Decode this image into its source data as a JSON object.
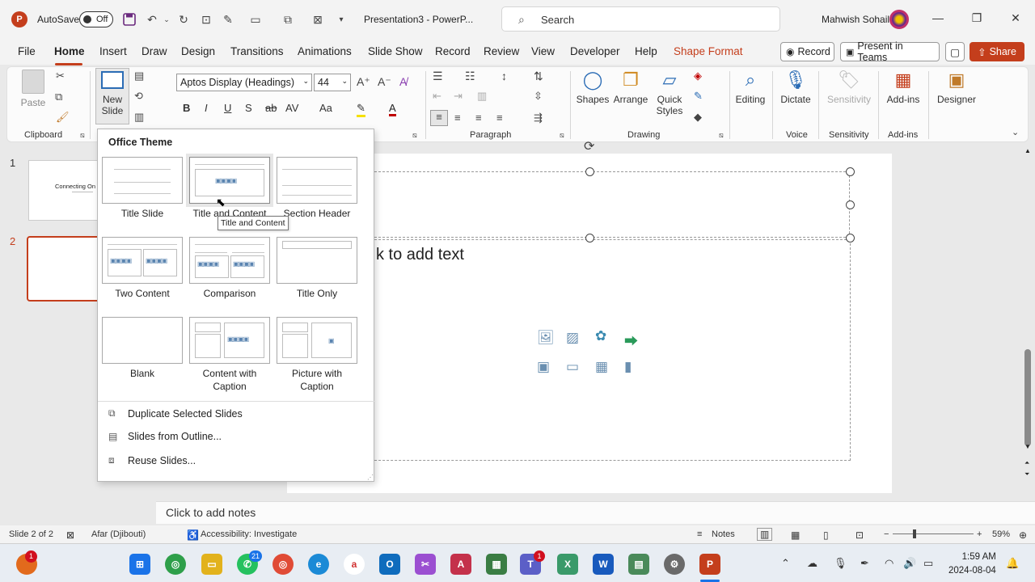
{
  "titlebar": {
    "autosave_label": "AutoSave",
    "autosave_state": "Off",
    "doc_title": "Presentation3  -  PowerP...",
    "search_placeholder": "Search",
    "user_name": "Mahwish Sohail"
  },
  "tabs": [
    "File",
    "Home",
    "Insert",
    "Draw",
    "Design",
    "Transitions",
    "Animations",
    "Slide Show",
    "Record",
    "Review",
    "View",
    "Developer",
    "Help",
    "Shape Format"
  ],
  "tab_buttons": {
    "record": "Record",
    "present": "Present in Teams",
    "share": "Share"
  },
  "ribbon": {
    "clipboard": {
      "paste": "Paste",
      "label": "Clipboard"
    },
    "slides": {
      "new_slide_1": "New",
      "new_slide_2": "Slide"
    },
    "font": {
      "name": "Aptos Display (Headings)",
      "size": "44"
    },
    "paragraph_label": "Paragraph",
    "drawing": {
      "shapes": "Shapes",
      "arrange": "Arrange",
      "quick_1": "Quick",
      "quick_2": "Styles",
      "label": "Drawing"
    },
    "editing": "Editing",
    "voice": {
      "dictate": "Dictate",
      "label": "Voice"
    },
    "sensitivity": {
      "btn": "Sensitivity",
      "label": "Sensitivity"
    },
    "addins": {
      "btn": "Add-ins",
      "label": "Add-ins"
    },
    "designer": "Designer"
  },
  "slides_panel": {
    "slide1_num": "1",
    "slide1_title": "Connecting On",
    "slide2_num": "2"
  },
  "slide": {
    "body_placeholder": "k to add text"
  },
  "layout_menu": {
    "theme": "Office Theme",
    "layouts": [
      "Title Slide",
      "Title and Content",
      "Section Header",
      "Two Content",
      "Comparison",
      "Title Only",
      "Blank",
      "Content with Caption",
      "Picture with Caption"
    ],
    "tooltip": "Title and Content",
    "items": [
      "Duplicate Selected Slides",
      "Slides from Outline...",
      "Reuse Slides..."
    ]
  },
  "notes": "Click to add notes",
  "status": {
    "slide": "Slide 2 of 2",
    "language": "Afar (Djibouti)",
    "accessibility": "Accessibility: Investigate",
    "notes_btn": "Notes",
    "zoom": "59%"
  },
  "taskbar": {
    "time": "1:59 AM",
    "date": "2024-08-04",
    "whatsapp_badge": "21",
    "teams_badge": "1",
    "start_badge": "1"
  },
  "colors": {
    "accent": "#c43e1c",
    "ribbon_icon": "#2b6cb5"
  }
}
